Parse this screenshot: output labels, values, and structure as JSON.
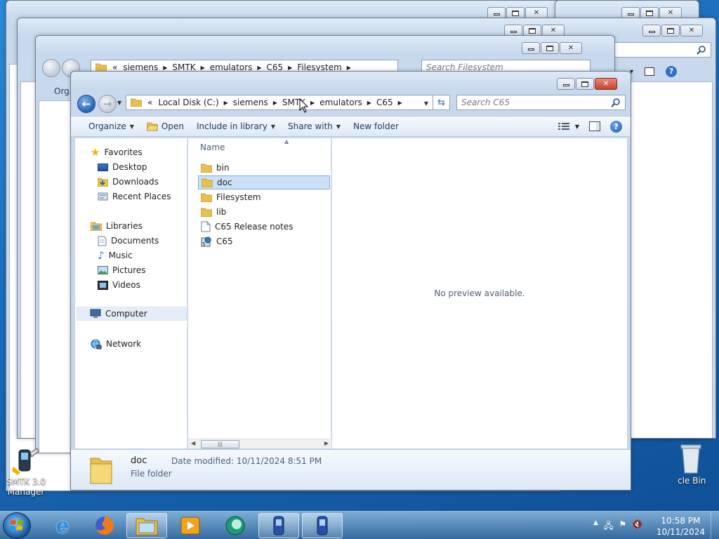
{
  "main_window": {
    "breadcrumb": [
      "Local Disk (C:)",
      "siemens",
      "SMTK",
      "emulators",
      "C65"
    ],
    "breadcrumb_prefix": "«",
    "search_placeholder": "Search C65",
    "toolbar": {
      "organize": "Organize",
      "open": "Open",
      "include_in_library": "Include in library",
      "share_with": "Share with",
      "new_folder": "New folder"
    },
    "nav": {
      "favorites": "Favorites",
      "desktop": "Desktop",
      "downloads": "Downloads",
      "recent_places": "Recent Places",
      "libraries": "Libraries",
      "documents": "Documents",
      "music": "Music",
      "pictures": "Pictures",
      "videos": "Videos",
      "computer": "Computer",
      "network": "Network"
    },
    "column_name": "Name",
    "files": [
      {
        "name": "bin",
        "type": "folder"
      },
      {
        "name": "doc",
        "type": "folder",
        "selected": true
      },
      {
        "name": "Filesystem",
        "type": "folder"
      },
      {
        "name": "lib",
        "type": "folder"
      },
      {
        "name": "C65 Release notes",
        "type": "document"
      },
      {
        "name": "C65",
        "type": "program"
      }
    ],
    "preview_text": "No preview available.",
    "details": {
      "name": "doc",
      "date_modified": "Date modified: 10/11/2024 8:51 PM",
      "type": "File folder"
    }
  },
  "background_window": {
    "breadcrumb": [
      "siemens",
      "SMTK",
      "emulators",
      "C65",
      "Filesystem"
    ],
    "breadcrumb_prefix": "«",
    "search_placeholder": "Search Filesystem",
    "organize_partial": "Orga",
    "search_partial": "tors"
  },
  "desktop": {
    "smtk_icon_label": "SMTK 3.0 Manager",
    "recycle_bin_partial": "cle Bin"
  },
  "taskbar": {
    "time": "10:58 PM",
    "date": "10/11/2024"
  }
}
